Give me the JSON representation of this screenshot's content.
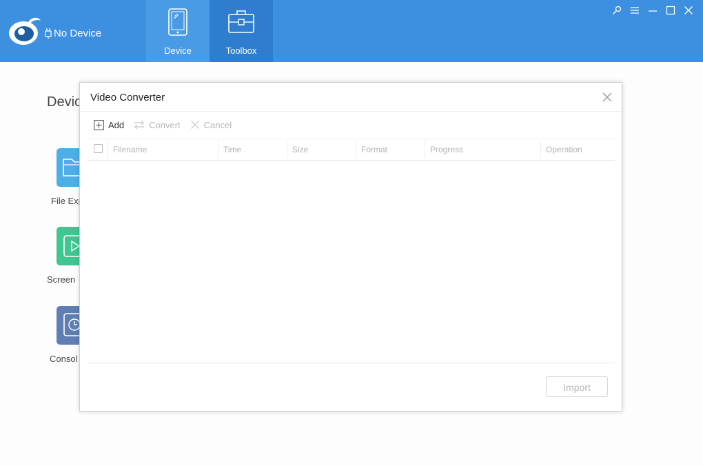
{
  "header": {
    "device_status": "No Device",
    "tabs": [
      {
        "label": "Device"
      },
      {
        "label": "Toolbox"
      }
    ],
    "colors": {
      "bar": "#3d8fe0",
      "active_tab": "#2f7dcf"
    },
    "window_controls": [
      "pin-icon",
      "menu-icon",
      "minimize-icon",
      "maximize-icon",
      "close-icon"
    ]
  },
  "page": {
    "title": "Devic",
    "tools": [
      {
        "label": "File Exp",
        "icon": "folder-icon",
        "color": "#4daee8"
      },
      {
        "label": "Screen",
        "icon": "play-icon",
        "color": "#3fc693"
      },
      {
        "label": "Consol",
        "icon": "clock-icon",
        "color": "#5f7fb3"
      }
    ]
  },
  "modal": {
    "title": "Video Converter",
    "toolbar": {
      "add": "Add",
      "convert": "Convert",
      "cancel": "Cancel"
    },
    "columns": [
      "Filename",
      "Time",
      "Size",
      "Format",
      "Progress",
      "Operation"
    ],
    "rows": [],
    "import_label": "Import"
  }
}
